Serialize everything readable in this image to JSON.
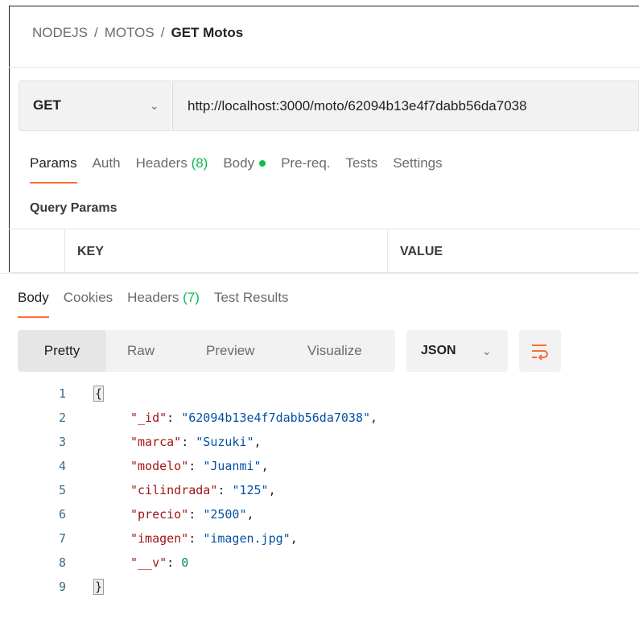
{
  "breadcrumb": {
    "parts": [
      "NODEJS",
      "MOTOS"
    ],
    "separator": "/",
    "current": "GET Motos"
  },
  "request": {
    "method": "GET",
    "url": "http://localhost:3000/moto/62094b13e4f7dabb56da7038"
  },
  "request_tabs": [
    {
      "label": "Params"
    },
    {
      "label": "Auth"
    },
    {
      "label": "Headers",
      "count": "(8)"
    },
    {
      "label": "Body"
    },
    {
      "label": "Pre-req."
    },
    {
      "label": "Tests"
    },
    {
      "label": "Settings"
    }
  ],
  "query_params": {
    "title": "Query Params",
    "key_header": "KEY",
    "value_header": "VALUE"
  },
  "response_tabs": [
    {
      "label": "Body"
    },
    {
      "label": "Cookies"
    },
    {
      "label": "Headers",
      "count": "(7)"
    },
    {
      "label": "Test Results"
    }
  ],
  "view_options": [
    "Pretty",
    "Raw",
    "Preview",
    "Visualize"
  ],
  "format_select": "JSON",
  "colors": {
    "accent": "#ff6c37",
    "status_green": "#0cbb52",
    "json_key": "#a31515",
    "json_string": "#0451a5",
    "json_number": "#098658"
  },
  "response_json": {
    "open": "{",
    "close": "}",
    "line_numbers": [
      "1",
      "2",
      "3",
      "4",
      "5",
      "6",
      "7",
      "8",
      "9"
    ],
    "entries": [
      {
        "key": "\"_id\"",
        "value": "\"62094b13e4f7dabb56da7038\"",
        "comma": ","
      },
      {
        "key": "\"marca\"",
        "value": "\"Suzuki\"",
        "comma": ","
      },
      {
        "key": "\"modelo\"",
        "value": "\"Juanmi\"",
        "comma": ","
      },
      {
        "key": "\"cilindrada\"",
        "value": "\"125\"",
        "comma": ","
      },
      {
        "key": "\"precio\"",
        "value": "\"2500\"",
        "comma": ","
      },
      {
        "key": "\"imagen\"",
        "value": "\"imagen.jpg\"",
        "comma": ","
      },
      {
        "key": "\"__v\"",
        "value": "0",
        "comma": ""
      }
    ]
  }
}
